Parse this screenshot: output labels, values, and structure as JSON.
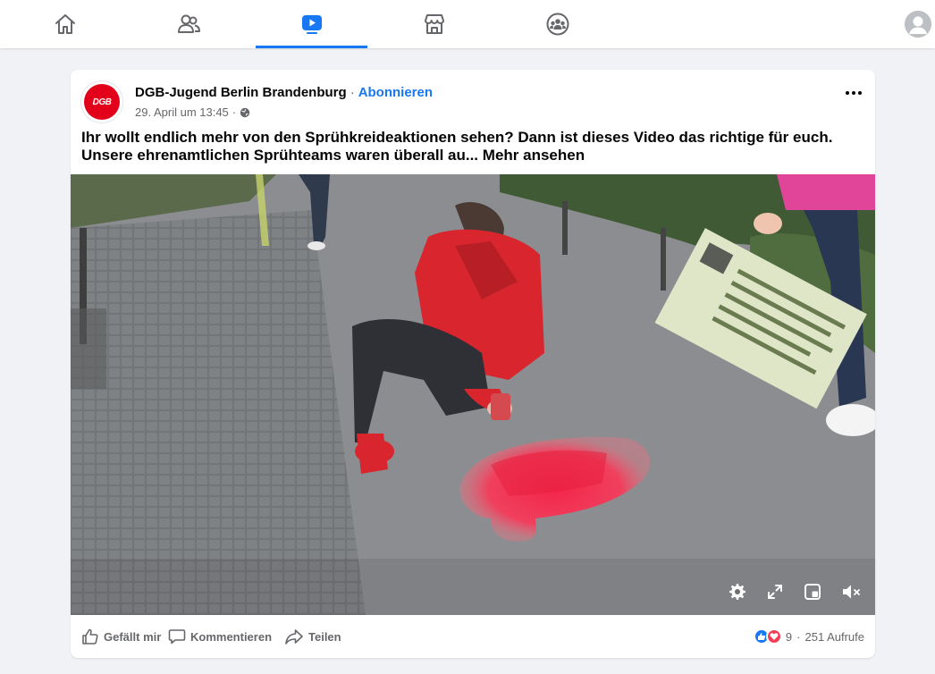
{
  "colors": {
    "accent": "#1877f2",
    "muted": "#65676b",
    "brand_red": "#e3001b"
  },
  "nav": {
    "tabs": [
      {
        "name": "home",
        "icon": "home-icon",
        "active": false
      },
      {
        "name": "friends",
        "icon": "friends-icon",
        "active": false
      },
      {
        "name": "watch",
        "icon": "watch-icon",
        "active": true
      },
      {
        "name": "marketplace",
        "icon": "marketplace-icon",
        "active": false
      },
      {
        "name": "groups",
        "icon": "groups-icon",
        "active": false
      }
    ],
    "profile_icon": "avatar-icon"
  },
  "post": {
    "page_logo_text": "DGB",
    "page_name": "DGB-Jugend Berlin Brandenburg",
    "separator": "·",
    "subscribe_label": "Abonnieren",
    "timestamp": "29. April um 13:45",
    "meta_separator": "·",
    "privacy_icon": "globe-icon",
    "more_icon": "more-options-icon",
    "text_line1": "Ihr wollt endlich mehr von den Sprühkreideaktionen sehen? Dann ist dieses Video das richtige für euch.",
    "text_line2": "Unsere ehrenamtlichen Sprühteams waren überall au...",
    "see_more": "Mehr ansehen",
    "video": {
      "controls": [
        "settings-icon",
        "fullscreen-icon",
        "picture-in-picture-icon",
        "muted-icon"
      ]
    },
    "actions": {
      "like": "Gefällt mir",
      "comment": "Kommentieren",
      "share": "Teilen"
    },
    "stats": {
      "reactions_count": "9",
      "separator": "·",
      "views": "251 Aufrufe"
    }
  }
}
